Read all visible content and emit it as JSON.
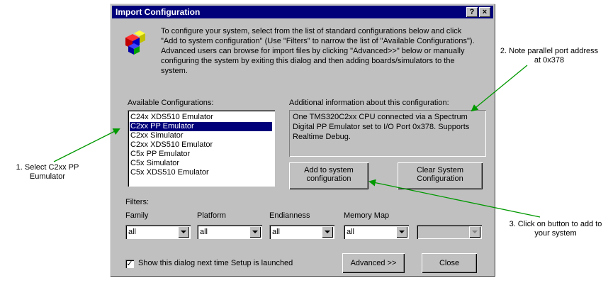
{
  "dialog": {
    "title": "Import Configuration",
    "help_button": "?",
    "close_button": "×",
    "intro": "To configure your system, select from the list of standard configurations below and click \"Add to system configuration\" (Use \"Filters\" to narrow the list of \"Available Configurations\"). Advanced users can browse for import files by clicking \"Advanced>>\" below or manually configuring the system by exiting this dialog and then adding boards/simulators to the system.",
    "available_label": "Available Configurations:",
    "configurations": [
      {
        "label": "C24x XDS510 Emulator",
        "selected": false
      },
      {
        "label": "C2xx PP Emulator",
        "selected": true
      },
      {
        "label": "C2xx Simulator",
        "selected": false
      },
      {
        "label": "C2xx XDS510 Emulator",
        "selected": false
      },
      {
        "label": "C5x PP Emulator",
        "selected": false
      },
      {
        "label": "C5x Simulator",
        "selected": false
      },
      {
        "label": "C5x XDS510 Emulator",
        "selected": false
      }
    ],
    "info_label": "Additional information about this configuration:",
    "info_text": "One TMS320C2xx CPU connected via a Spectrum Digital PP Emulator set to I/O Port 0x378. Supports Realtime Debug.",
    "add_button": "Add to system configuration",
    "clear_button": "Clear System Configuration",
    "filters_label": "Filters:",
    "filters": {
      "family": {
        "label": "Family",
        "value": "all"
      },
      "platform": {
        "label": "Platform",
        "value": "all"
      },
      "endianness": {
        "label": "Endianness",
        "value": "all"
      },
      "memory_map": {
        "label": "Memory Map",
        "value": "all"
      },
      "extra": {
        "value": ""
      }
    },
    "show_checkbox_label": "Show this dialog next time Setup is launched",
    "show_checkbox_checked": true,
    "advanced_button": "Advanced >>",
    "close_button_label": "Close"
  },
  "annotations": {
    "note1": "1.  Select C2xx PP Eumulator",
    "note2": "2.  Note parallel port address at 0x378",
    "note3": "3.  Click on button to add to your system",
    "arrow_color": "#009900"
  }
}
